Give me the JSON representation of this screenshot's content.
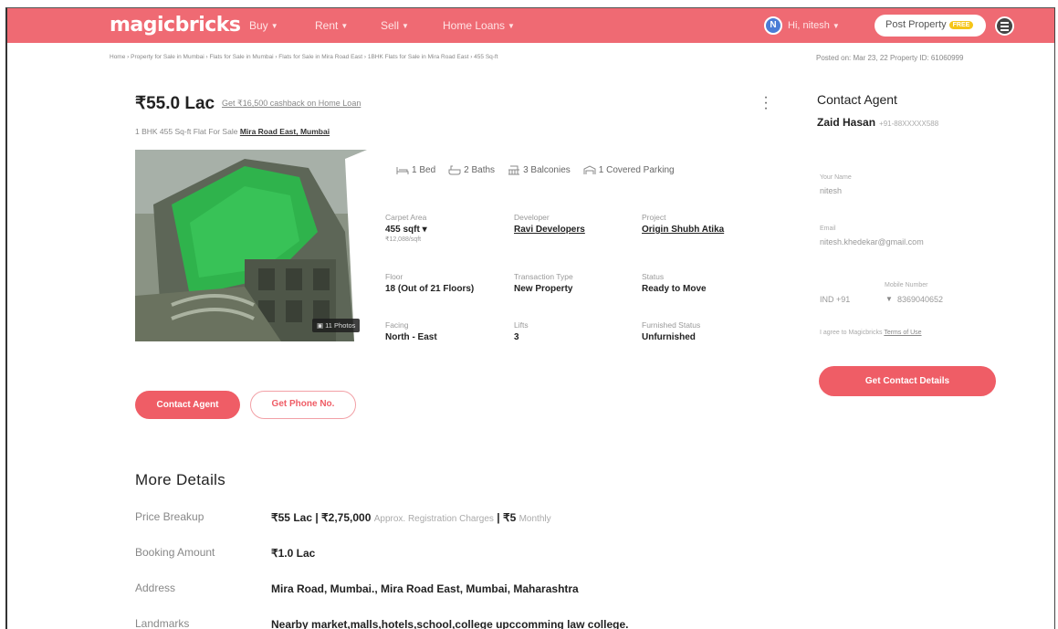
{
  "header": {
    "logo": "magicbricks",
    "nav": [
      "Buy",
      "Rent",
      "Sell",
      "Home Loans"
    ],
    "user_initial": "N",
    "user_name": "Hi, nitesh",
    "post_property": "Post Property",
    "post_badge": "FREE"
  },
  "breadcrumb": "Home › Property for Sale in Mumbai › Flats for Sale in Mumbai › Flats for Sale in Mira Road East › 1BHK Flats for Sale in Mira Road East › 455 Sq-ft",
  "posted_info": "Posted on: Mar 23, 22     Property ID: 61060999",
  "listing": {
    "price": "₹55.0 Lac",
    "cashback": "Get ₹16,500 cashback on Home Loan",
    "subtitle": "1 BHK 455 Sq-ft Flat For Sale",
    "location": "Mira Road East, Mumbai",
    "photos_badge": "11 Photos",
    "amenities": [
      "1 Bed",
      "2 Baths",
      "3 Balconies",
      "1 Covered Parking"
    ],
    "details": [
      {
        "label": "Carpet Area",
        "value": "455 sqft",
        "sub": "₹12,088/sqft"
      },
      {
        "label": "Developer",
        "value": "Ravi Developers"
      },
      {
        "label": "Project",
        "value": "Origin Shubh Atika"
      },
      {
        "label": "Floor",
        "value": "18 (Out of 21 Floors)"
      },
      {
        "label": "Transaction Type",
        "value": "New Property"
      },
      {
        "label": "Status",
        "value": "Ready to Move"
      },
      {
        "label": "Facing",
        "value": "North - East"
      },
      {
        "label": "Lifts",
        "value": "3"
      },
      {
        "label": "Furnished Status",
        "value": "Unfurnished"
      }
    ],
    "contact_agent_button": "Contact Agent",
    "get_phone_button": "Get Phone No."
  },
  "contact": {
    "title": "Contact Agent",
    "agent_name": "Zaid Hasan",
    "agent_phone": "+91-88XXXXX588",
    "name_label": "Your Name",
    "name_value": "nitesh",
    "email_label": "Email",
    "email_value": "nitesh.khedekar@gmail.com",
    "mobile_label": "Mobile Number",
    "isd": "IND +91",
    "mobile_value": "8369040652",
    "agree_text": "I agree to Magicbricks",
    "terms_link": "Terms of Use",
    "details_button": "Get Contact Details"
  },
  "more_details": {
    "title": "More Details",
    "rows": [
      {
        "key": "Price Breakup",
        "value": "₹55 Lac | ₹2,75,000",
        "muted": "Approx. Registration Charges",
        "value2": "| ₹5",
        "muted2": "Monthly"
      },
      {
        "key": "Booking Amount",
        "value": "₹1.0 Lac"
      },
      {
        "key": "Address",
        "value": "Mira Road, Mumbai., Mira Road East, Mumbai, Maharashtra"
      },
      {
        "key": "Landmarks",
        "value": "Nearby market,malls,hotels,school,college upccomming law college."
      }
    ]
  },
  "colors": {
    "brand": "#ef6a73",
    "button": "#ef5d66",
    "avatar": "#4a7cd6"
  }
}
